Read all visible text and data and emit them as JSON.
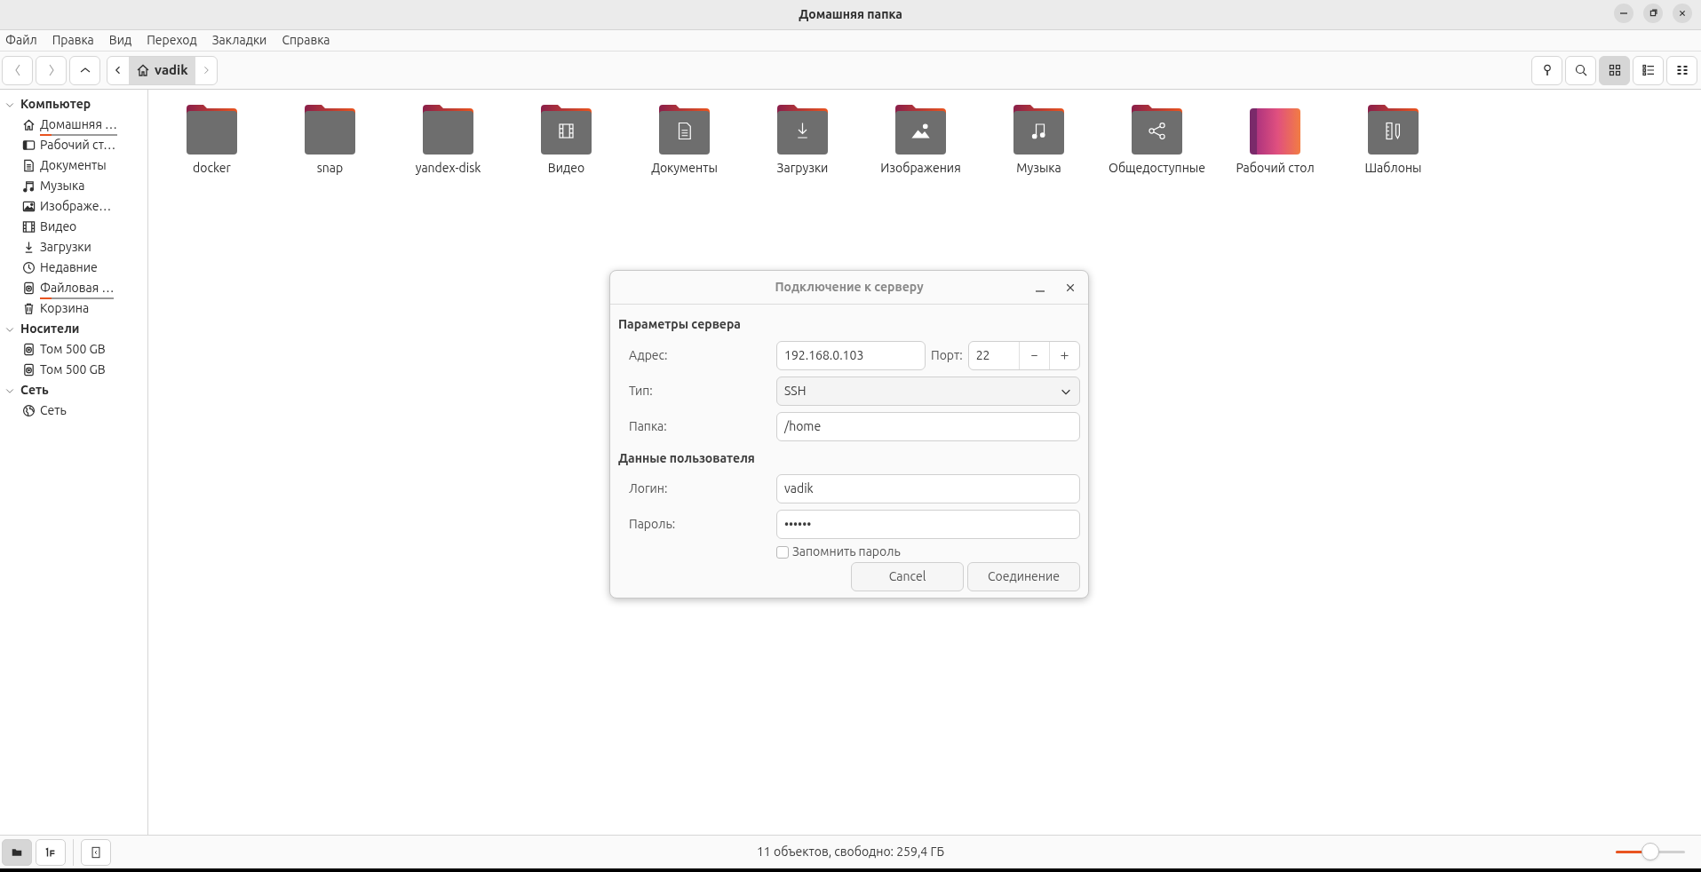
{
  "window": {
    "title": "Домашняя папка"
  },
  "menu": [
    "Файл",
    "Правка",
    "Вид",
    "Переход",
    "Закладки",
    "Справка"
  ],
  "path_bar": {
    "crumb": "vadik"
  },
  "view_buttons": [
    {
      "kind": "location",
      "selected": false
    },
    {
      "kind": "search",
      "selected": false
    },
    {
      "kind": "grid",
      "selected": true
    },
    {
      "kind": "list",
      "selected": false
    },
    {
      "kind": "compact",
      "selected": false
    }
  ],
  "sidebar": {
    "sections": [
      {
        "title": "Компьютер",
        "expanded": true,
        "items": [
          {
            "label": "Домашняя …",
            "kind": "home",
            "level": 0.15
          },
          {
            "label": "Рабочий ст…",
            "kind": "desktop"
          },
          {
            "label": "Документы",
            "kind": "documents"
          },
          {
            "label": "Музыка",
            "kind": "music"
          },
          {
            "label": "Изображе…",
            "kind": "pictures"
          },
          {
            "label": "Видео",
            "kind": "video"
          },
          {
            "label": "Загрузки",
            "kind": "downloads"
          },
          {
            "label": "Недавние",
            "kind": "recent"
          },
          {
            "label": "Файловая …",
            "kind": "disk",
            "level": 0.15
          },
          {
            "label": "Корзина",
            "kind": "trash"
          }
        ]
      },
      {
        "title": "Носители",
        "expanded": true,
        "items": [
          {
            "label": "Том 500 GB",
            "kind": "disk"
          },
          {
            "label": "Том 500 GB",
            "kind": "disk"
          }
        ]
      },
      {
        "title": "Сеть",
        "expanded": true,
        "items": [
          {
            "label": "Сеть",
            "kind": "network"
          }
        ]
      }
    ]
  },
  "files": [
    {
      "name": "docker",
      "kind": "folder"
    },
    {
      "name": "snap",
      "kind": "folder"
    },
    {
      "name": "yandex-disk",
      "kind": "folder"
    },
    {
      "name": "Видео",
      "kind": "video"
    },
    {
      "name": "Документы",
      "kind": "documents"
    },
    {
      "name": "Загрузки",
      "kind": "downloads"
    },
    {
      "name": "Изображения",
      "kind": "pictures"
    },
    {
      "name": "Музыка",
      "kind": "music"
    },
    {
      "name": "Общедоступные",
      "kind": "share"
    },
    {
      "name": "Рабочий стол",
      "kind": "desktop"
    },
    {
      "name": "Шаблоны",
      "kind": "templates"
    }
  ],
  "dialog": {
    "title": "Подключение к серверу",
    "server_section": "Параметры сервера",
    "address_label": "Адрес:",
    "address": "192.168.0.103",
    "port_label": "Порт:",
    "port": "22",
    "type_label": "Тип:",
    "type": "SSH",
    "folder_label": "Папка:",
    "folder": "/home",
    "user_section": "Данные пользователя",
    "login_label": "Логин:",
    "login": "vadik",
    "password_label": "Пароль:",
    "password": "••••••",
    "remember": {
      "label": "Запомнить пароль",
      "checked": false
    },
    "buttons": [
      "Cancel",
      "Соединение"
    ]
  },
  "status_bar": {
    "places_selected": true,
    "tree_selected": false,
    "text": "11 объектов, свободно: 259,4 ГБ",
    "zoom": {
      "level": 0.5
    }
  }
}
